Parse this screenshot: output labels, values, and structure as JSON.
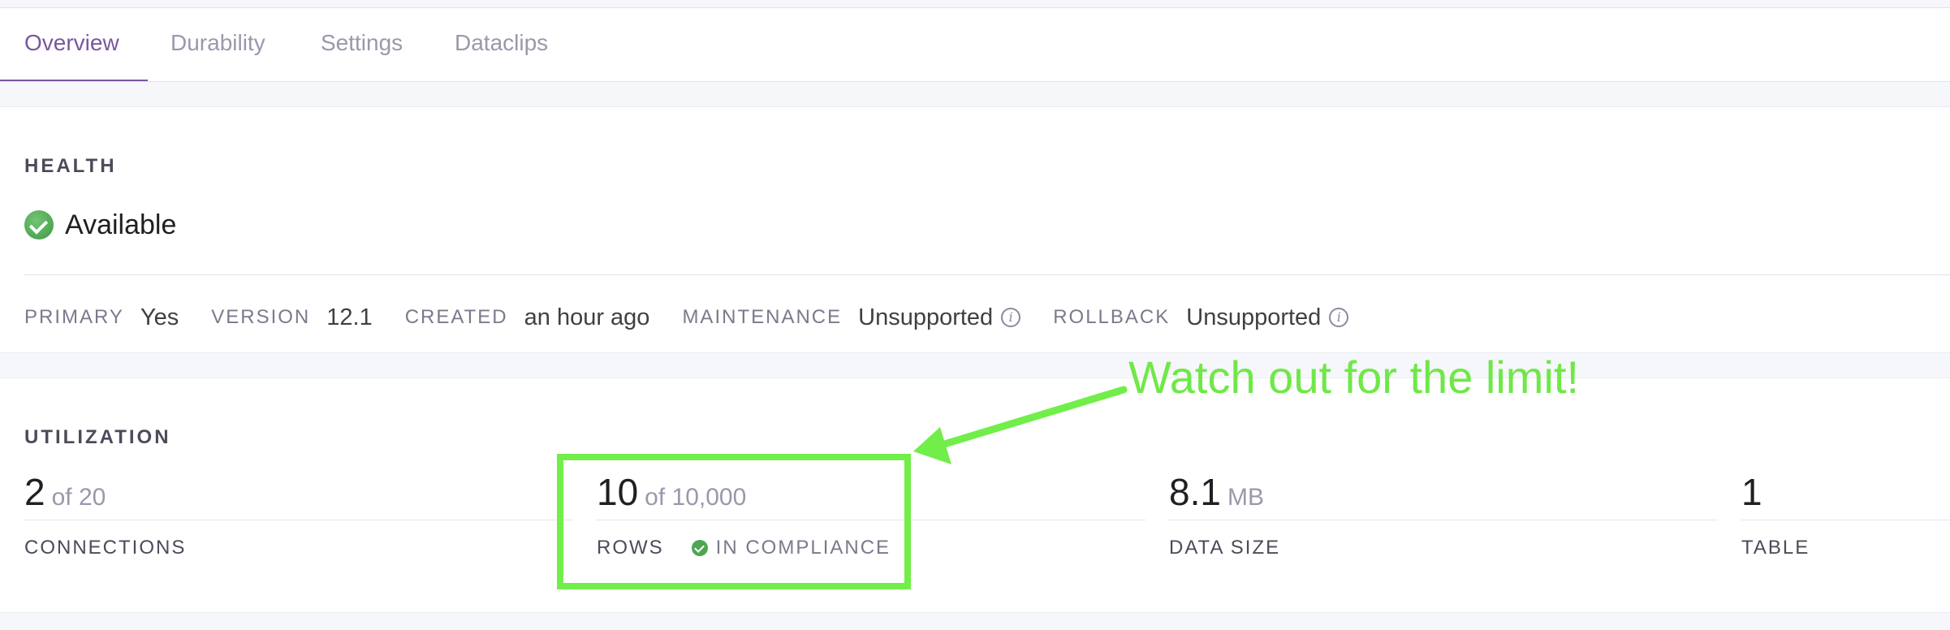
{
  "tabs": [
    {
      "label": "Overview",
      "active": true
    },
    {
      "label": "Durability",
      "active": false
    },
    {
      "label": "Settings",
      "active": false
    },
    {
      "label": "Dataclips",
      "active": false
    }
  ],
  "health": {
    "title": "HEALTH",
    "status": "Available",
    "meta": [
      {
        "label": "PRIMARY",
        "value": "Yes"
      },
      {
        "label": "VERSION",
        "value": "12.1"
      },
      {
        "label": "CREATED",
        "value": "an hour ago"
      },
      {
        "label": "MAINTENANCE",
        "value": "Unsupported",
        "info": true
      },
      {
        "label": "ROLLBACK",
        "value": "Unsupported",
        "info": true
      }
    ]
  },
  "utilization": {
    "title": "UTILIZATION",
    "metrics": [
      {
        "value": "2",
        "sub": "of 20",
        "label": "CONNECTIONS"
      },
      {
        "value": "10",
        "sub": "of 10,000",
        "label": "ROWS",
        "badge": "IN COMPLIANCE"
      },
      {
        "value": "8.1",
        "sub": "MB",
        "label": "DATA SIZE"
      },
      {
        "value": "1",
        "sub": "",
        "label": "TABLE"
      }
    ]
  },
  "annotation": {
    "text": "Watch out for the limit!",
    "color": "#71ee49"
  },
  "colors": {
    "accent": "#79589f",
    "success": "#4ea653"
  }
}
